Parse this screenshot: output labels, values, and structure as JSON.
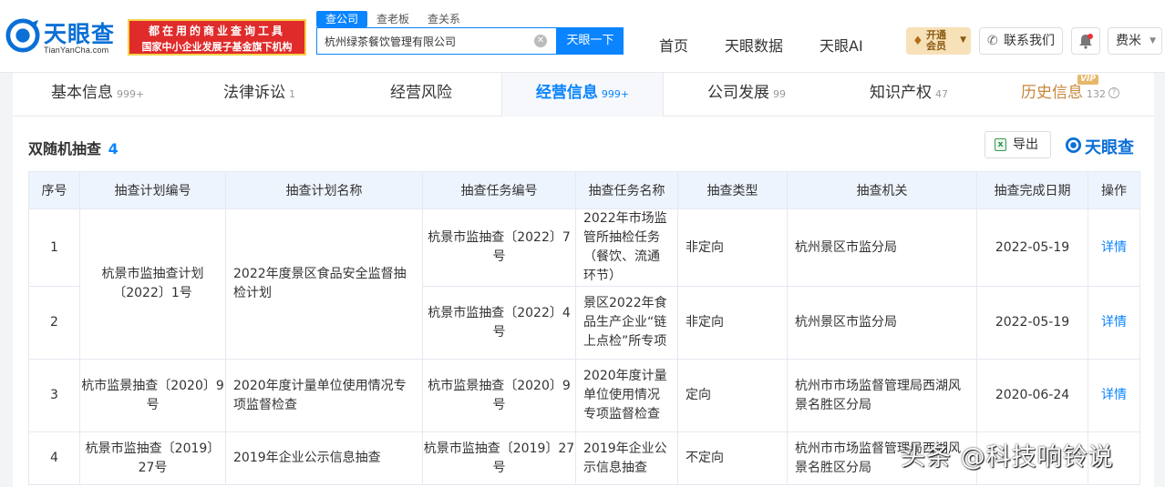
{
  "brand": {
    "name": "天眼查",
    "domain": "TianYanCha.com",
    "promo_line1": "都在用的商业查询工具",
    "promo_line2": "国家中小企业发展子基金旗下机构"
  },
  "search": {
    "tabs": [
      "查公司",
      "查老板",
      "查关系"
    ],
    "value": "杭州绿茶餐饮管理有限公司",
    "button": "天眼一下"
  },
  "nav": {
    "links": [
      "首页",
      "天眼数据",
      "天眼AI"
    ],
    "vip_line1": "开通",
    "vip_line2": "会员",
    "contact": "联系我们",
    "user": "费米"
  },
  "main_tabs": [
    {
      "label": "基本信息",
      "count": "999+"
    },
    {
      "label": "法律诉讼",
      "count": "1"
    },
    {
      "label": "经营风险",
      "count": ""
    },
    {
      "label": "经营信息",
      "count": "999+"
    },
    {
      "label": "公司发展",
      "count": "99"
    },
    {
      "label": "知识产权",
      "count": "47"
    },
    {
      "label": "历史信息",
      "count": "132",
      "tag": "VIP"
    }
  ],
  "section": {
    "title": "双随机抽查",
    "count": "4",
    "export": "导出",
    "brand": "天眼查"
  },
  "table": {
    "headers": [
      "序号",
      "抽查计划编号",
      "抽查计划名称",
      "抽查任务编号",
      "抽查任务名称",
      "抽查类型",
      "抽查机关",
      "抽查完成日期",
      "操作"
    ],
    "plan_groups": [
      {
        "plan_no": "杭景市监抽查计划〔2022〕1号",
        "plan_name": "2022年度景区食品安全监督抽检计划"
      },
      {
        "plan_no": "杭市监景抽查〔2020〕9号",
        "plan_name": "2020年度计量单位使用情况专项监督检查"
      },
      {
        "plan_no": "杭景市监抽查〔2019〕27号",
        "plan_name": "2019年企业公示信息抽查"
      }
    ],
    "rows": [
      {
        "no": "1",
        "task_no": "杭景市监抽查〔2022〕7号",
        "task_name": "2022年市场监管所抽检任务（餐饮、流通环节）",
        "type": "非定向",
        "authority": "杭州景区市监分局",
        "date": "2022-05-19",
        "action": "详情"
      },
      {
        "no": "2",
        "task_no": "杭景市监抽查〔2022〕4号",
        "task_name": "景区2022年食品生产企业“链上点检”所专项",
        "type": "非定向",
        "authority": "杭州景区市监分局",
        "date": "2022-05-19",
        "action": "详情"
      },
      {
        "no": "3",
        "task_no": "杭市监景抽查〔2020〕9号",
        "task_name": "2020年度计量单位使用情况专项监督检查",
        "type": "定向",
        "authority": "杭州市市场监督管理局西湖风景名胜区分局",
        "date": "2020-06-24",
        "action": "详情"
      },
      {
        "no": "4",
        "task_no": "杭景市监抽查〔2019〕27号",
        "task_name": "2019年企业公示信息抽查",
        "type": "不定向",
        "authority": "杭州市市场监督管理局西湖风景名胜区分局",
        "date": "",
        "action": ""
      }
    ]
  },
  "watermark": "头条 @科技响铃说"
}
